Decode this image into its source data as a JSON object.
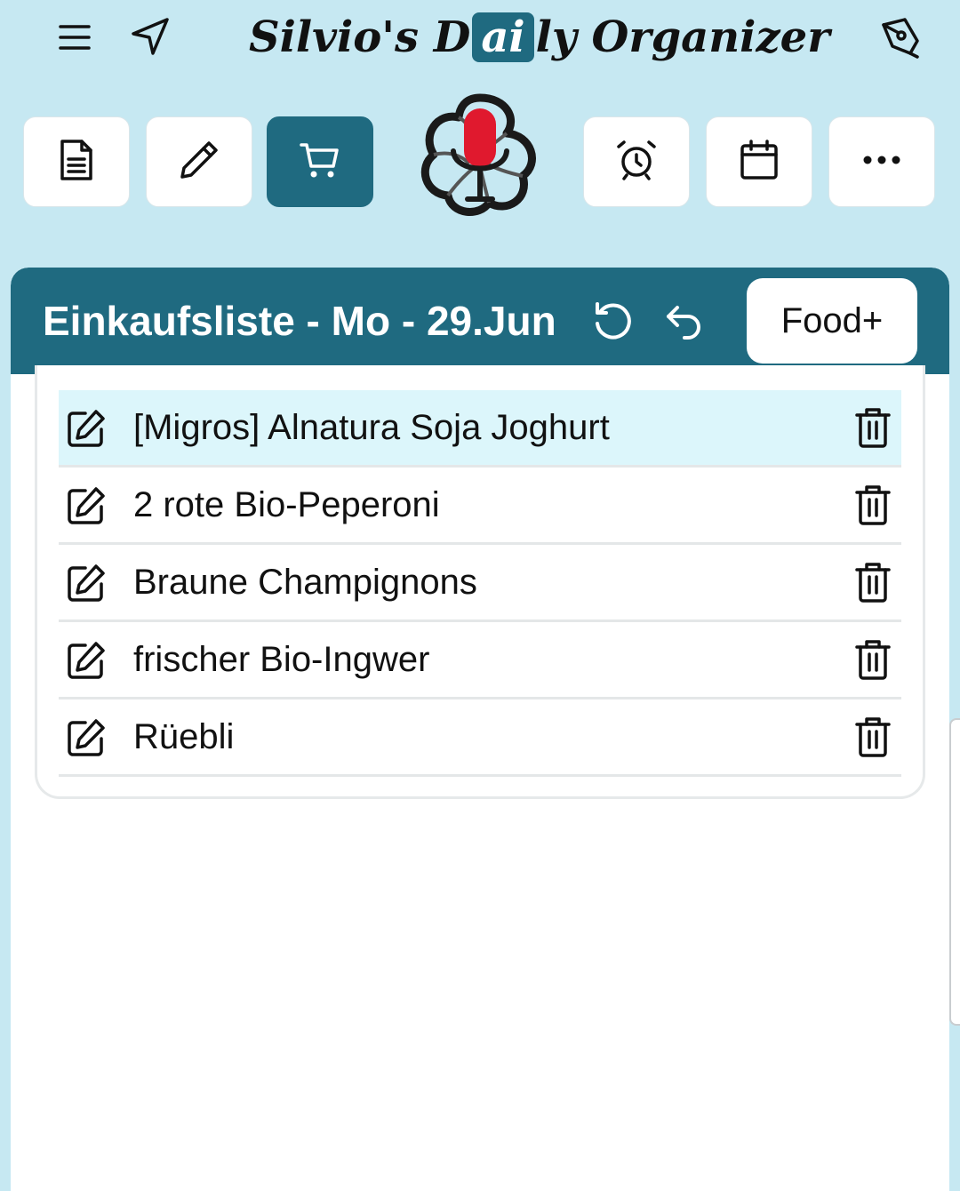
{
  "app": {
    "title_prefix": "Silvio's D",
    "title_highlight": "ai",
    "title_suffix": "ly Organizer"
  },
  "icons": {
    "menu": "menu-icon",
    "navigate": "navigation-arrow-icon",
    "pen": "pen-tool-icon",
    "document": "document-icon",
    "pencil": "pencil-icon",
    "cart": "shopping-cart-icon",
    "mic": "microphone-ai-logo",
    "alarm": "alarm-clock-icon",
    "calendar": "calendar-icon",
    "more": "more-horizontal-icon",
    "refresh": "refresh-icon",
    "undo": "undo-icon",
    "edit": "edit-icon",
    "delete": "trash-icon"
  },
  "colors": {
    "background": "#c6e8f2",
    "accent": "#1f6a80",
    "highlight_row": "#dcf6fb",
    "mic_red": "#e0192e"
  },
  "shopping": {
    "header_title": "Einkaufsliste - Mo - 29.Jun",
    "food_button": "Food+",
    "items": [
      {
        "label": "[Migros] Alnatura Soja Joghurt",
        "highlighted": true
      },
      {
        "label": "2 rote Bio-Peperoni",
        "highlighted": false
      },
      {
        "label": "Braune Champignons",
        "highlighted": false
      },
      {
        "label": "frischer Bio-Ingwer",
        "highlighted": false
      },
      {
        "label": "Rüebli",
        "highlighted": false
      }
    ]
  }
}
